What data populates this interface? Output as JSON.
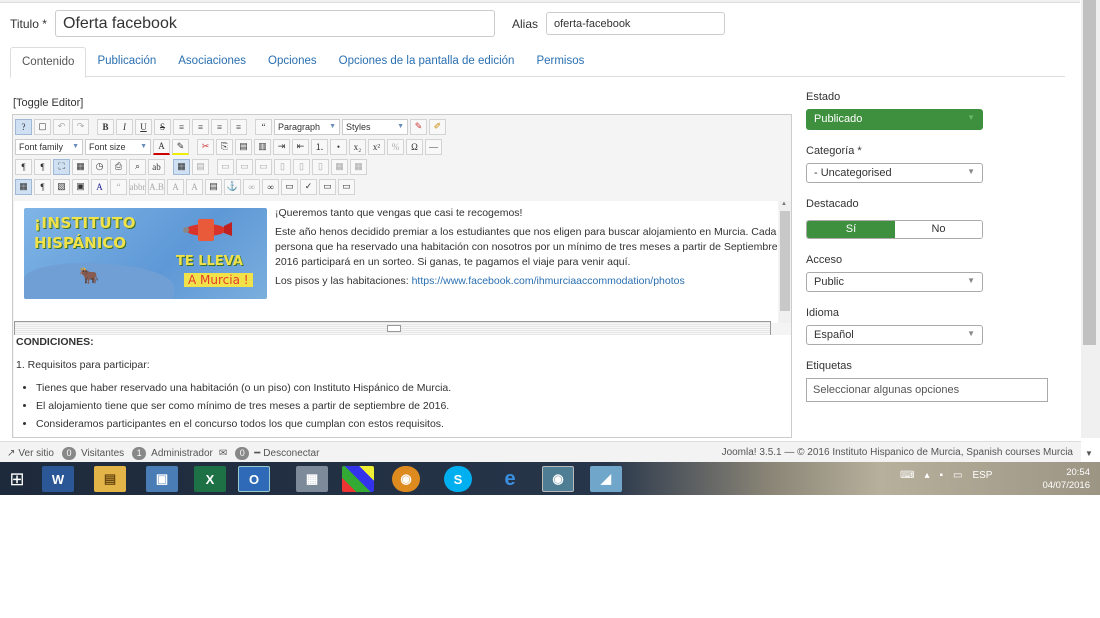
{
  "form": {
    "title_label": "Titulo *",
    "title_value": "Oferta facebook",
    "alias_label": "Alias",
    "alias_value": "oferta-facebook"
  },
  "tabs": [
    {
      "label": "Contenido",
      "active": true
    },
    {
      "label": "Publicación"
    },
    {
      "label": "Asociaciones"
    },
    {
      "label": "Opciones"
    },
    {
      "label": "Opciones de la pantalla de edición"
    },
    {
      "label": "Permisos"
    }
  ],
  "editor": {
    "toggle_label": "[Toggle Editor]",
    "format_select": "Paragraph",
    "styles_select": "Styles",
    "font_family_select": "Font family",
    "font_size_select": "Font size",
    "banner": {
      "line1": "¡INSTITUTO",
      "line2": "HISPÁNICO",
      "line3": "TE LLEVA",
      "line4": "A Murcia !"
    },
    "para1": "¡Queremos tanto que vengas que casi te recogemos!",
    "para2": "Este año henos decidido premiar a los estudiantes que nos eligen para buscar alojamiento en Murcia. Cada persona que ha reservado una habitación con nosotros por un mínimo de tres meses a partir de Septiembre 2016 participará en un sorteo. Si ganas, te pagamos el viaje para venir aquí.",
    "para3_prefix": "Los pisos y las habitaciones:",
    "para3_link": "https://www.facebook.com/ihmurciaaccommodation/photos",
    "conditions_heading": "CONDICIONES:",
    "requirements": "1. Requisitos para participar:",
    "bullets": [
      "Tienes que haber reservado una habitación (o un piso) con Instituto Hispánico de Murcia.",
      "El alojamiento tiene que ser como mínimo de tres meses a partir de septiembre de 2016.",
      "Consideramos participantes en el concurso todos los que cumplan con estos requisitos."
    ]
  },
  "sidebar": {
    "estado_label": "Estado",
    "estado_value": "Publicado",
    "categoria_label": "Categoría *",
    "categoria_value": "- Uncategorised",
    "destacado_label": "Destacado",
    "destacado_yes": "Sí",
    "destacado_no": "No",
    "acceso_label": "Acceso",
    "acceso_value": "Public",
    "idioma_label": "Idioma",
    "idioma_value": "Español",
    "etiquetas_label": "Etiquetas",
    "etiquetas_placeholder": "Seleccionar algunas opciones"
  },
  "statusbar": {
    "view_site": "Ver sitio",
    "visitors_count": "0",
    "visitors_label": "Visitantes",
    "admin_count": "1",
    "admin_label": "Administrador",
    "messages_count": "0",
    "logout": "Desconectar",
    "footer": "Joomla! 3.5.1 — © 2016 Instituto Hispanico de Murcia, Spanish courses Murcia"
  },
  "taskbar": {
    "lang": "ESP",
    "time": "20:54",
    "date": "04/07/2016"
  },
  "colors": {
    "accent_green": "#3e8f3e",
    "link_blue": "#2a6fb0"
  }
}
